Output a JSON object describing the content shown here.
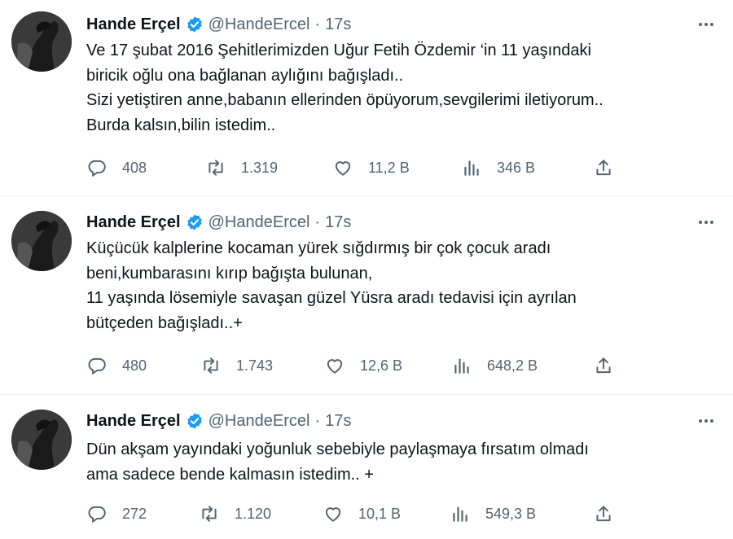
{
  "tweets": [
    {
      "name": "Hande Erçel",
      "handle": "@HandeErcel",
      "separator": "·",
      "time": "17s",
      "lines": [
        "Ve 17 şubat 2016 Şehitlerimizden Uğur Fetih Özdemir ‘in 11 yaşındaki",
        "biricik oğlu ona bağlanan aylığını bağışladı..",
        "Sizi yetiştiren anne,babanın ellerinden öpüyorum,sevgilerimi iletiyorum..",
        "Burda kalsın,bilin istedim.."
      ],
      "replies": "408",
      "retweets": "1.319",
      "likes": "11,2 B",
      "views": "346 B"
    },
    {
      "name": "Hande Erçel",
      "handle": "@HandeErcel",
      "separator": "·",
      "time": "17s",
      "lines": [
        "Küçücük kalplerine kocaman yürek sığdırmış bir çok çocuk aradı",
        "beni,kumbarasını kırıp bağışta bulunan,",
        "11 yaşında lösemiyle savaşan güzel Yüsra aradı tedavisi için ayrılan",
        "bütçeden bağışladı..+"
      ],
      "replies": "480",
      "retweets": "1.743",
      "likes": "12,6 B",
      "views": "648,2 B"
    },
    {
      "name": "Hande Erçel",
      "handle": "@HandeErcel",
      "separator": "·",
      "time": "17s",
      "lines": [
        "Dün akşam yayındaki yoğunluk sebebiyle paylaşmaya fırsatım olmadı",
        "ama sadece bende kalmasın istedim.. +"
      ],
      "replies": "272",
      "retweets": "1.120",
      "likes": "10,1 B",
      "views": "549,3 B"
    }
  ],
  "colors": {
    "text": "#0f1419",
    "muted": "#536471",
    "verified": "#1d9bf0",
    "divider": "#eff3f4"
  },
  "icons": [
    "verified-badge-icon",
    "more-icon",
    "reply-icon",
    "retweet-icon",
    "like-icon",
    "views-icon",
    "share-icon"
  ]
}
